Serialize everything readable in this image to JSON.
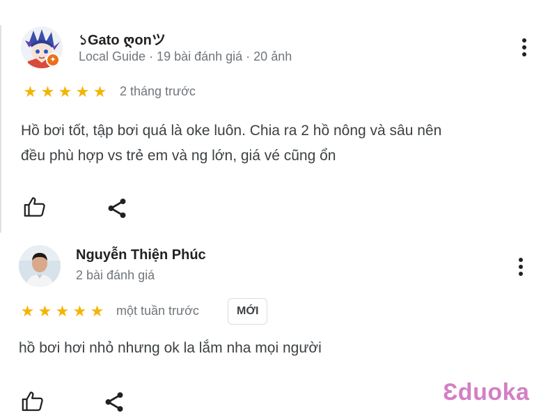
{
  "reviews": [
    {
      "author": "১Gato ღonツ",
      "meta": "Local Guide · 19 bài đánh giá · 20 ảnh",
      "rating": 5,
      "stars": "★★★★★",
      "time": "2 tháng trước",
      "text_lines": [
        "Hồ bơi tốt, tập bơi quá là oke luôn. Chia ra 2 hồ nông và sâu nên",
        "đều phù hợp vs trẻ em và ng lớn, giá vé cũng ổn"
      ]
    },
    {
      "author": "Nguyễn Thiện Phúc",
      "meta": "2 bài đánh giá",
      "rating": 5,
      "stars": "★★★★★",
      "time": "một tuần trước",
      "badge": "MỚI",
      "text_lines": [
        "hồ bơi hơi nhỏ nhưng ok la lắm nha mọi người"
      ]
    }
  ],
  "watermark": "Ɛduoka",
  "colors": {
    "star": "#f4b400",
    "guide_badge": "#e8711a",
    "watermark": "#d37fc5",
    "secondary_text": "#70757a"
  },
  "icons": [
    "more-vert-icon",
    "thumbs-up-icon",
    "share-icon",
    "local-guide-badge-icon",
    "star-icon"
  ]
}
